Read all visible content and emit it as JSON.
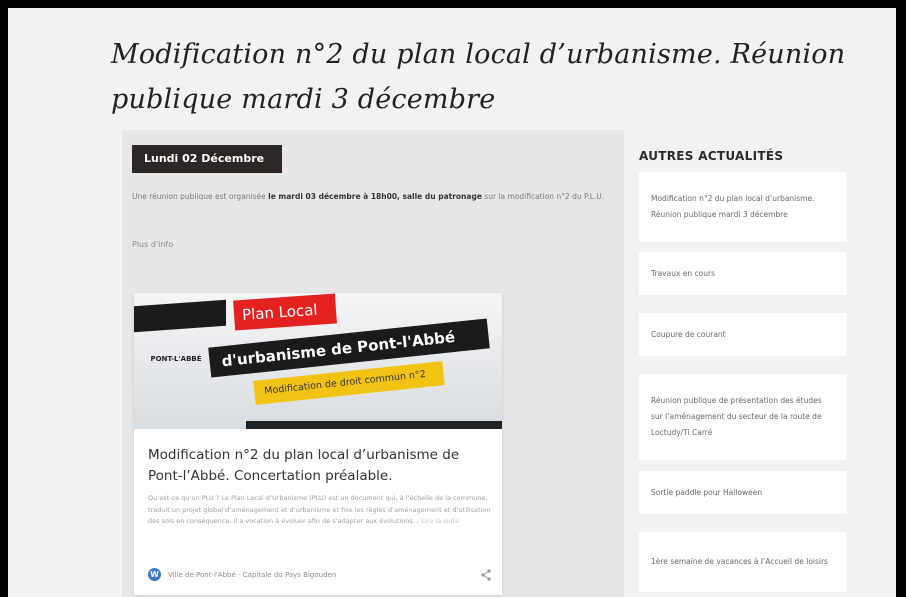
{
  "page": {
    "title": "Modification n°2 du plan local d’urbanisme. Réunion publique mardi 3 décembre"
  },
  "article": {
    "date_badge": "Lundi 02 Décembre",
    "intro_before": "Une réunion publique est organisée ",
    "intro_bold": "le mardi 03 décembre à 18h00, salle du patronage",
    "intro_after": " sur la modification n°2 du P.L.U.",
    "more_info": "Plus d'info"
  },
  "card": {
    "image": {
      "red_banner": "Plan Local",
      "dark_banner": "d'urbanisme de Pont-l'Abbé",
      "yellow_banner": "Modification de droit commun n°2",
      "logo": "PONT-L'ABBÉ"
    },
    "title": "Modification n°2 du plan local d’urbanisme de Pont-l’Abbé. Concertation préalable.",
    "excerpt": "Qu’est-ce qu’un PLU ? Le Plan Local d’Urbanisme (PLU) est un document qui, à l’échelle de la commune, traduit un projet global d’aménagement et d’urbanisme et fixe les règles d’aménagement et d’utilisation des sols en conséquence. Il a vocation à évoluer afin de s’adapter aux évolutions…",
    "read_more": "Lire la suite",
    "site_name": "Ville de Pont-l'Abbé - Capitale du Pays Bigouden",
    "wp_icon_glyph": "W"
  },
  "sidebar": {
    "title": "AUTRES ACTUALITÉS",
    "items": [
      {
        "label": "Modification n°2 du plan local d’urbanisme. Réunion publique mardi 3 décembre"
      },
      {
        "label": "Travaux en cours"
      },
      {
        "label": "Coupure de courant"
      },
      {
        "label": "Réunion publique de présentation des études sur l’aménagement du secteur de la route de Loctudy/Ti Carré"
      },
      {
        "label": "Sortie paddle pour Halloween"
      },
      {
        "label": "1ère semaine de vacances à l’Accueil de loisirs"
      }
    ]
  },
  "colors": {
    "badge_bg": "#2c2725",
    "red_banner": "#e3221f",
    "yellow_banner": "#f2c314",
    "wp_blue": "#3b77c4"
  }
}
